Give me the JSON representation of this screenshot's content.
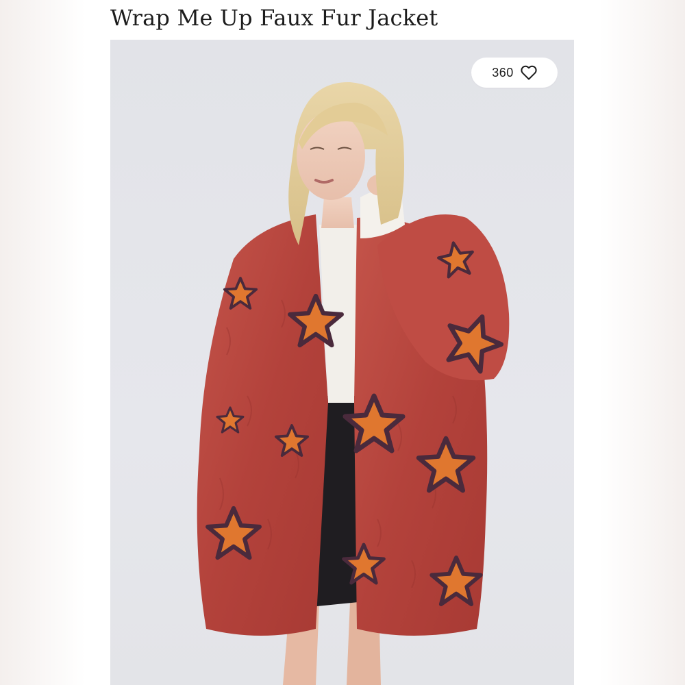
{
  "listing": {
    "title": "Wrap Me Up Faux Fur Jacket",
    "photo_alt": "Wrap Me Up Faux Fur Jacket",
    "likes": {
      "count": "360",
      "icon": "heart-outline-icon"
    }
  },
  "colors": {
    "background": "#ffffff",
    "photo_background": "#e4e5ea",
    "coat": "#b8473f",
    "stars": "#e07a33",
    "text": "#1c1c1c"
  }
}
